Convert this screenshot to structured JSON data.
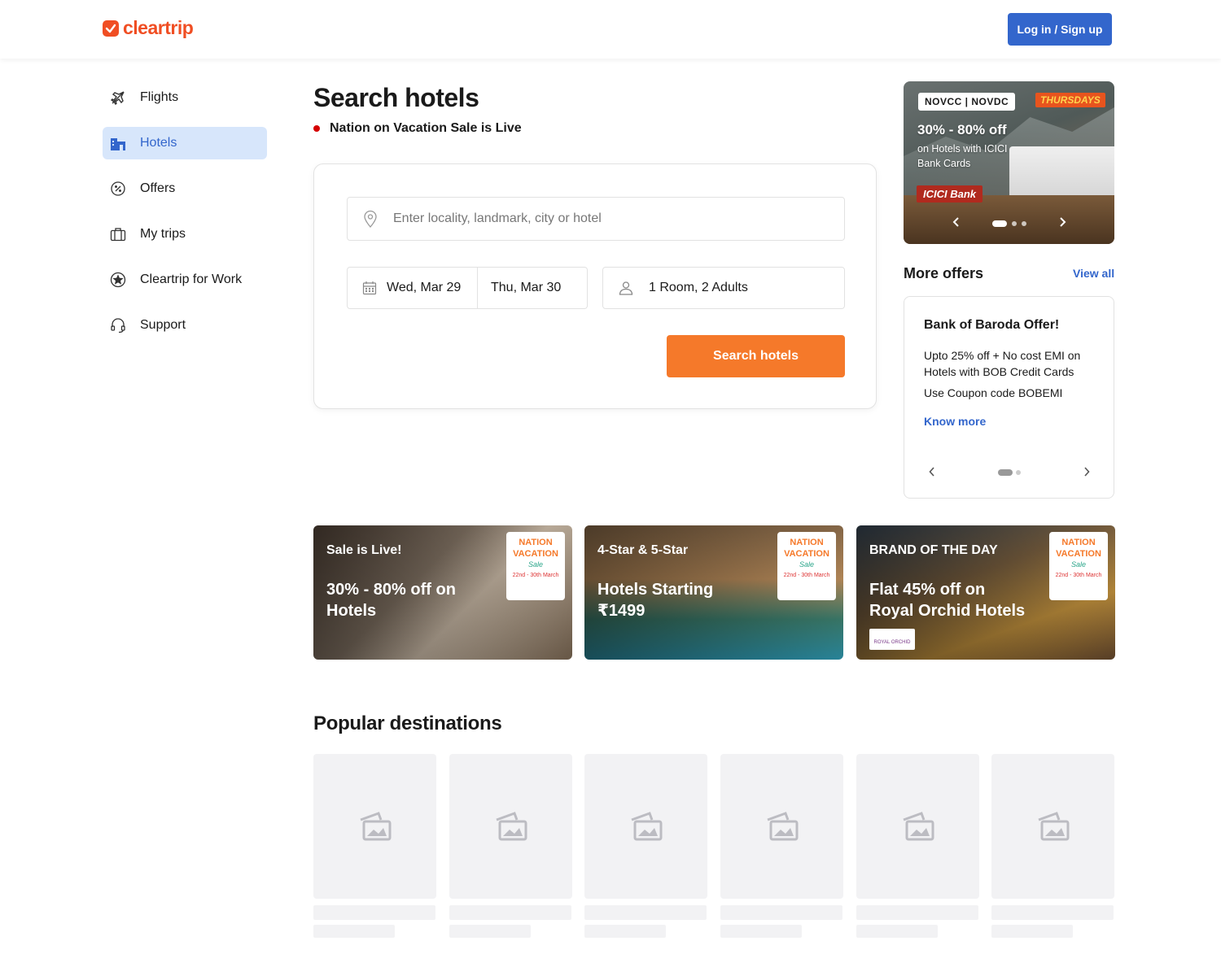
{
  "header": {
    "logo_text": "cleartrip",
    "login_label": "Log in / Sign up"
  },
  "sidebar": {
    "items": [
      {
        "label": "Flights",
        "icon": "airplane-icon"
      },
      {
        "label": "Hotels",
        "icon": "hotel-icon",
        "active": true
      },
      {
        "label": "Offers",
        "icon": "offer-icon"
      },
      {
        "label": "My trips",
        "icon": "suitcase-icon"
      },
      {
        "label": "Cleartrip for Work",
        "icon": "star-badge-icon"
      },
      {
        "label": "Support",
        "icon": "headset-icon"
      }
    ]
  },
  "main": {
    "title": "Search hotels",
    "live_text": "Nation on Vacation Sale is Live",
    "search": {
      "location_placeholder": "Enter locality, landmark, city or hotel",
      "checkin": "Wed, Mar 29",
      "checkout": "Thu, Mar 30",
      "guests": "1 Room, 2 Adults",
      "button_label": "Search hotels"
    }
  },
  "hero_offer": {
    "codes": "NOVCC | NOVDC",
    "tag": "THURSDAYS",
    "headline": "30% - 80% off",
    "sub": "on Hotels with ICICI Bank Cards",
    "bank": "ICICI Bank"
  },
  "more_offers": {
    "title": "More offers",
    "view_all": "View all",
    "card": {
      "title": "Bank of Baroda Offer!",
      "desc": "Upto 25% off + No cost EMI on Hotels with BOB Credit Cards",
      "coupon": "Use Coupon code BOBEMI",
      "link": "Know more"
    }
  },
  "banners": [
    {
      "small": "Sale is Live!",
      "big": "30% - 80% off on Hotels"
    },
    {
      "small": "4-Star & 5-Star",
      "big": "Hotels Starting ₹1499"
    },
    {
      "small": "BRAND OF THE DAY",
      "big": "Flat 45% off on Royal Orchid Hotels",
      "logo": "ROYAL ORCHID"
    }
  ],
  "sale_badge": {
    "line1": "NATION",
    "line2": "VACATION",
    "line3": "Sale",
    "dates": "22nd - 30th March"
  },
  "popular": {
    "title": "Popular destinations"
  },
  "colors": {
    "brand": "#f04e23",
    "primary_blue": "#3366cc",
    "search_orange": "#f5792a",
    "active_bg": "#d7e6fb",
    "live_red": "#d50000"
  }
}
